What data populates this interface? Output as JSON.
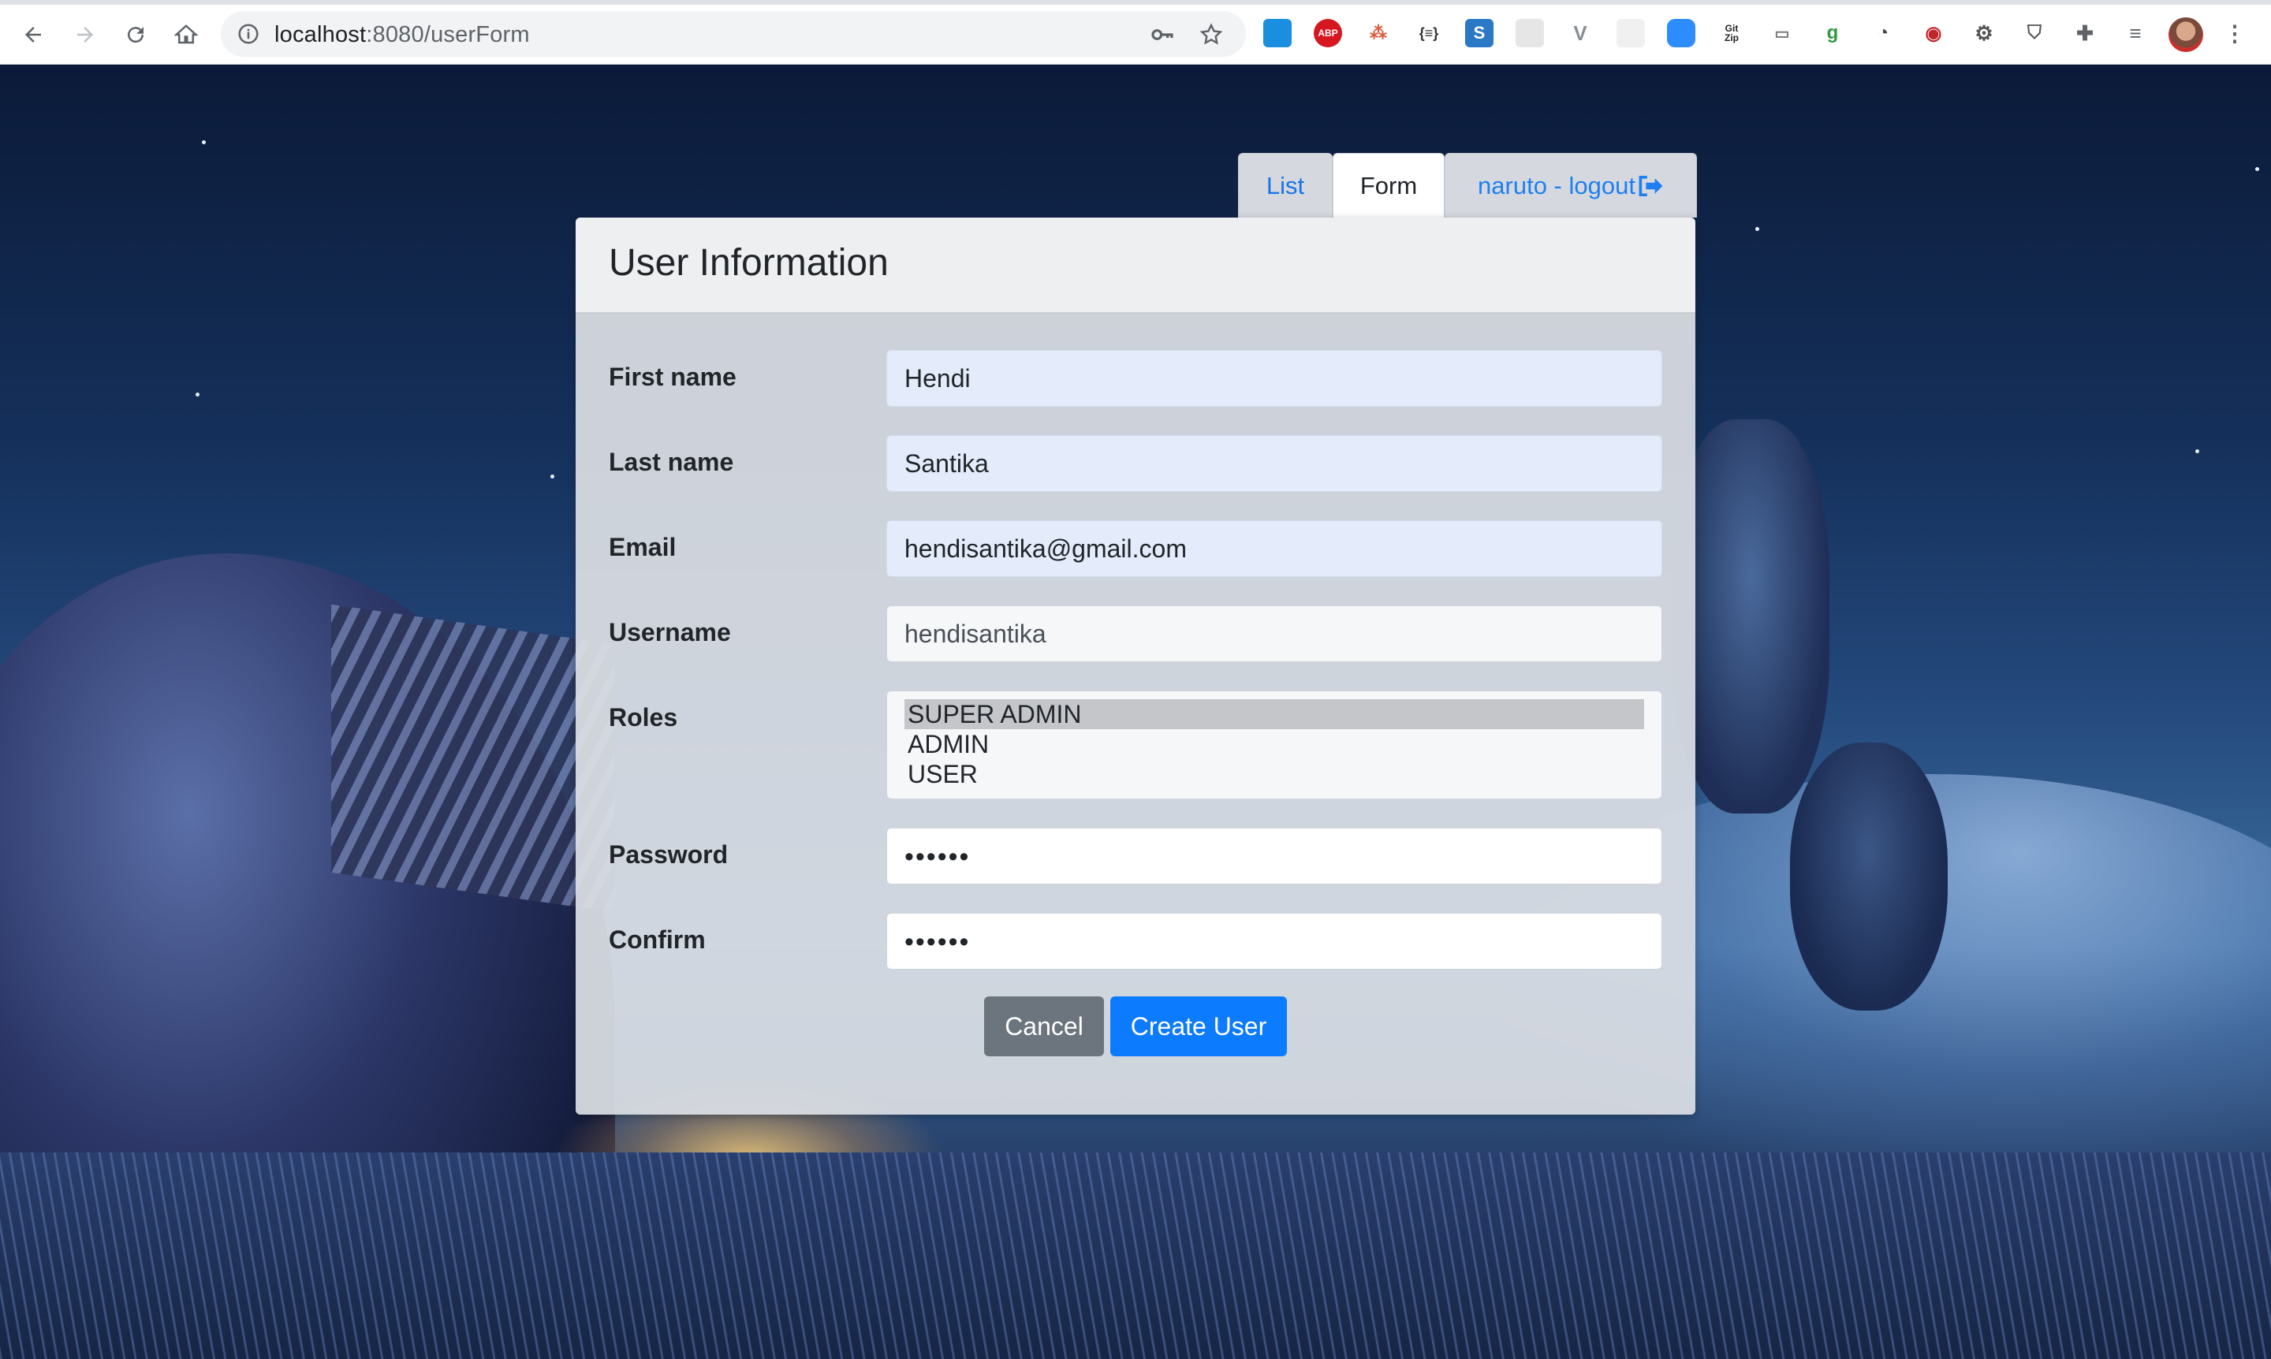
{
  "browser": {
    "url_host": "localhost",
    "url_path": ":8080/userForm"
  },
  "tabs": {
    "list_label": "List",
    "form_label": "Form",
    "logout_label": "naruto - logout"
  },
  "card": {
    "title": "User Information"
  },
  "form": {
    "first_name_label": "First name",
    "first_name_value": "Hendi",
    "last_name_label": "Last name",
    "last_name_value": "Santika",
    "email_label": "Email",
    "email_value": "hendisantika@gmail.com",
    "username_label": "Username",
    "username_value": "hendisantika",
    "roles_label": "Roles",
    "roles_options": [
      "SUPER ADMIN",
      "ADMIN",
      "USER"
    ],
    "roles_selected": "SUPER ADMIN",
    "password_label": "Password",
    "password_mask": "••••••",
    "confirm_label": "Confirm",
    "confirm_mask": "••••••",
    "cancel_label": "Cancel",
    "create_label": "Create User"
  },
  "colors": {
    "link_blue": "#1a73e8",
    "primary_button": "#0d7bfd",
    "secondary_button": "#6c757d"
  },
  "icons": {
    "logout": "sign-out-icon",
    "info": "info-icon",
    "key": "key-icon",
    "star": "star-icon"
  }
}
